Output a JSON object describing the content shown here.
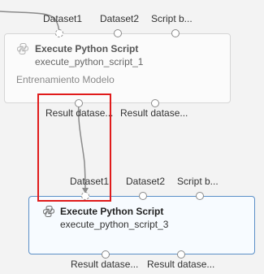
{
  "top_module": {
    "inputs": [
      "Dataset1",
      "Dataset2",
      "Script b..."
    ],
    "title": "Execute Python Script",
    "subtitle": "execute_python_script_1",
    "comment": "Entrenamiento Modelo",
    "outputs": [
      "Result datase...",
      "Result datase..."
    ],
    "icon": "python-script-icon"
  },
  "bottom_module": {
    "inputs": [
      "Dataset1",
      "Dataset2",
      "Script b..."
    ],
    "title": "Execute Python Script",
    "subtitle": "execute_python_script_3",
    "outputs": [
      "Result datase...",
      "Result datase..."
    ],
    "icon": "python-script-icon"
  },
  "colors": {
    "highlight": "#e01b1b",
    "selected_border": "#5b8fc7",
    "connector": "#8a8a8a"
  }
}
